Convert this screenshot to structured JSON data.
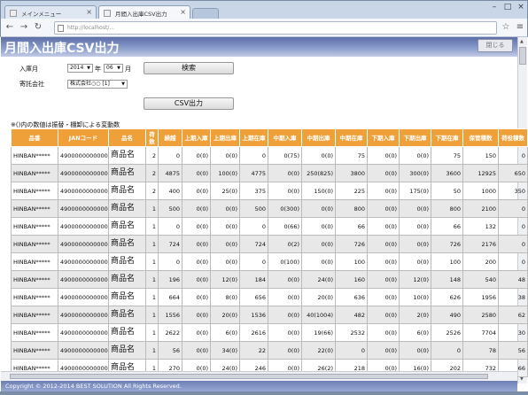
{
  "browser": {
    "tabs": [
      {
        "label": "メインメニュー"
      },
      {
        "label": "月間入出庫CSV出力"
      }
    ],
    "url": "http://localhost/..."
  },
  "page": {
    "title": "月間入出庫CSV出力",
    "close_label": "閉じる"
  },
  "form": {
    "month_label": "入庫月",
    "year_value": "2014",
    "year_unit": "年",
    "month_value": "06",
    "month_unit": "月",
    "search_label": "検索",
    "company_label": "寄託会社",
    "company_value": "株式会社○○ [1]",
    "csv_label": "CSV出力"
  },
  "note": "※()内の数値は振替・棚卸による変動数",
  "table": {
    "columns": [
      "品番",
      "JANコード",
      "品名",
      "荷数",
      "繰越",
      "上期入庫",
      "上期出庫",
      "上期在庫",
      "中期入庫",
      "中期出庫",
      "中期在庫",
      "下期入庫",
      "下期出庫",
      "下期在庫",
      "保管積数",
      "荷役積数"
    ],
    "rows": [
      [
        "HINBAN*****",
        "4900000000000",
        "商品名",
        "2",
        "0",
        "0(0)",
        "0(0)",
        "0",
        "0(75)",
        "0(0)",
        "75",
        "0(0)",
        "0(0)",
        "75",
        "150",
        "0"
      ],
      [
        "HINBAN*****",
        "4900000000000",
        "商品名",
        "2",
        "4875",
        "0(0)",
        "100(0)",
        "4775",
        "0(0)",
        "250(825)",
        "3800",
        "0(0)",
        "300(0)",
        "3600",
        "12925",
        "650"
      ],
      [
        "HINBAN*****",
        "4900000000000",
        "商品名",
        "2",
        "400",
        "0(0)",
        "25(0)",
        "375",
        "0(0)",
        "150(0)",
        "225",
        "0(0)",
        "175(0)",
        "50",
        "1000",
        "350"
      ],
      [
        "HINBAN*****",
        "4900000000000",
        "商品名",
        "1",
        "500",
        "0(0)",
        "0(0)",
        "500",
        "0(300)",
        "0(0)",
        "800",
        "0(0)",
        "0(0)",
        "800",
        "2100",
        "0"
      ],
      [
        "HINBAN*****",
        "4900000000000",
        "商品名",
        "1",
        "0",
        "0(0)",
        "0(0)",
        "0",
        "0(66)",
        "0(0)",
        "66",
        "0(0)",
        "0(0)",
        "66",
        "132",
        "0"
      ],
      [
        "HINBAN*****",
        "4900000000000",
        "商品名",
        "1",
        "724",
        "0(0)",
        "0(0)",
        "724",
        "0(2)",
        "0(0)",
        "726",
        "0(0)",
        "0(0)",
        "726",
        "2176",
        "0"
      ],
      [
        "HINBAN*****",
        "4900000000000",
        "商品名",
        "1",
        "0",
        "0(0)",
        "0(0)",
        "0",
        "0(100)",
        "0(0)",
        "100",
        "0(0)",
        "0(0)",
        "100",
        "200",
        "0"
      ],
      [
        "HINBAN*****",
        "4900000000000",
        "商品名",
        "1",
        "196",
        "0(0)",
        "12(0)",
        "184",
        "0(0)",
        "24(0)",
        "160",
        "0(0)",
        "12(0)",
        "148",
        "540",
        "48"
      ],
      [
        "HINBAN*****",
        "4900000000000",
        "商品名",
        "1",
        "664",
        "0(0)",
        "8(0)",
        "656",
        "0(0)",
        "20(0)",
        "636",
        "0(0)",
        "10(0)",
        "626",
        "1956",
        "38"
      ],
      [
        "HINBAN*****",
        "4900000000000",
        "商品名",
        "1",
        "1556",
        "0(0)",
        "20(0)",
        "1536",
        "0(0)",
        "40(1004)",
        "482",
        "0(0)",
        "2(0)",
        "490",
        "2580",
        "62"
      ],
      [
        "HINBAN*****",
        "4900000000000",
        "商品名",
        "1",
        "2622",
        "0(0)",
        "6(0)",
        "2616",
        "0(0)",
        "19(66)",
        "2532",
        "0(0)",
        "6(0)",
        "2526",
        "7704",
        "30"
      ],
      [
        "HINBAN*****",
        "4900000000000",
        "商品名",
        "1",
        "56",
        "0(0)",
        "34(0)",
        "22",
        "0(0)",
        "22(0)",
        "0",
        "0(0)",
        "0(0)",
        "0",
        "78",
        "56"
      ],
      [
        "HINBAN*****",
        "4900000000000",
        "商品名",
        "1",
        "270",
        "0(0)",
        "24(0)",
        "246",
        "0(0)",
        "26(2)",
        "218",
        "0(0)",
        "16(0)",
        "202",
        "732",
        "66"
      ]
    ]
  },
  "footer": "Copyright © 2012-2014 BEST SOLUTION All Rights Reserved."
}
